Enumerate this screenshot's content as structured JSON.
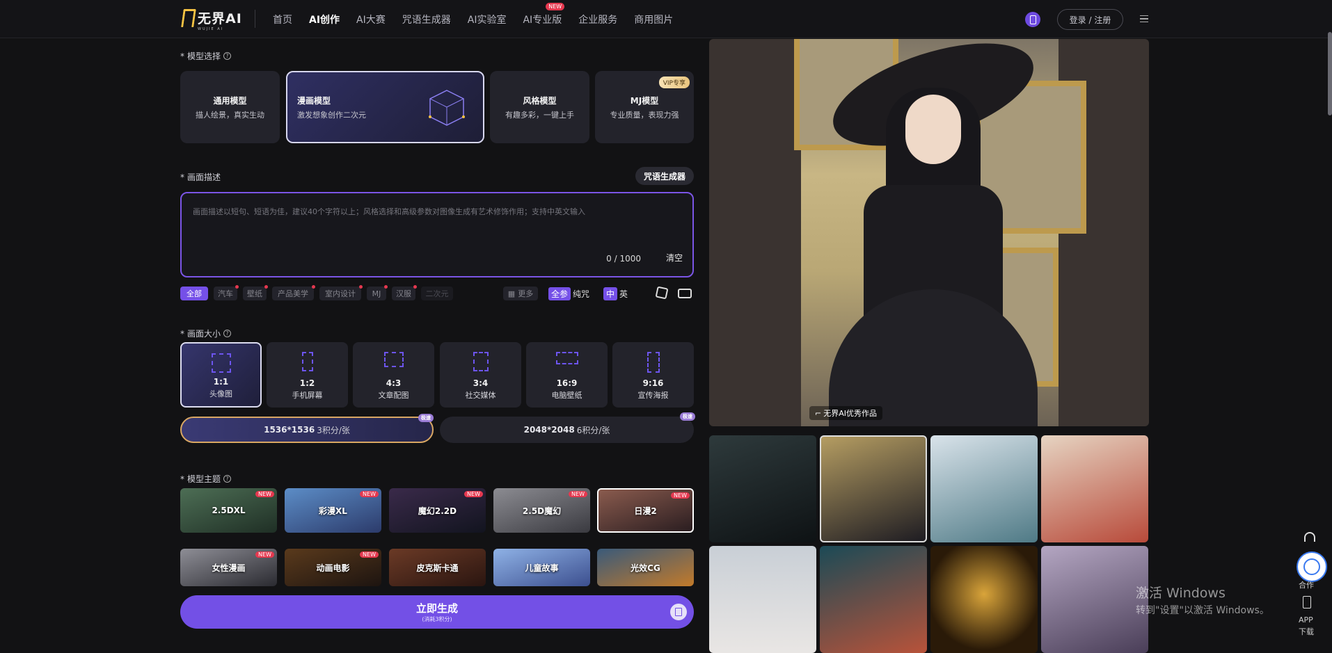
{
  "brand": {
    "name": "无界AI",
    "sub": "WUJIE AI"
  },
  "nav": [
    {
      "label": "首页"
    },
    {
      "label": "AI创作",
      "active": true
    },
    {
      "label": "AI大赛"
    },
    {
      "label": "咒语生成器"
    },
    {
      "label": "AI实验室"
    },
    {
      "label": "AI专业版",
      "badge": "NEW"
    },
    {
      "label": "企业服务"
    },
    {
      "label": "商用图片"
    }
  ],
  "header": {
    "login_label": "登录 / 注册"
  },
  "model_section": {
    "label": "模型选择",
    "cards": [
      {
        "title": "通用模型",
        "desc": "描人绘景，真实生动"
      },
      {
        "title": "漫画模型",
        "desc": "激发想象创作二次元",
        "selected": true
      },
      {
        "title": "风格模型",
        "desc": "有趣多彩，一键上手"
      },
      {
        "title": "MJ模型",
        "desc": "专业质量，表现力强",
        "badge": "VIP专享"
      }
    ]
  },
  "desc_section": {
    "label": "画面描述",
    "spell_button": "咒语生成器",
    "placeholder": "画面描述以短句、短语为佳，建议40个字符以上；风格选择和高级参数对图像生成有艺术修饰作用；支持中英文输入",
    "counter": "0 / 1000",
    "clear": "清空"
  },
  "tags": [
    {
      "label": "全部",
      "active": true
    },
    {
      "label": "汽车",
      "dot": true
    },
    {
      "label": "壁纸",
      "dot": true
    },
    {
      "label": "产品美学",
      "dot": true
    },
    {
      "label": "室内设计",
      "dot": true
    },
    {
      "label": "MJ",
      "dot": true
    },
    {
      "label": "汉服",
      "dot": true
    },
    {
      "label": "二次元",
      "fade": true
    }
  ],
  "tag_tools": {
    "more": "更多",
    "full_label": "全参",
    "pure_label": "纯咒",
    "zh_label": "中",
    "en_label": "英"
  },
  "size_section": {
    "label": "画面大小",
    "cards": [
      {
        "ratio": "1:1",
        "name": "头像图",
        "selected": true
      },
      {
        "ratio": "1:2",
        "name": "手机屏幕"
      },
      {
        "ratio": "4:3",
        "name": "文章配图"
      },
      {
        "ratio": "3:4",
        "name": "社交媒体"
      },
      {
        "ratio": "16:9",
        "name": "电脑壁纸"
      },
      {
        "ratio": "9:16",
        "name": "宣传海报"
      }
    ],
    "resolutions": [
      {
        "size": "1536*1536",
        "cost": "3积分/张",
        "badge": "极速",
        "selected": true
      },
      {
        "size": "2048*2048",
        "cost": "6积分/张",
        "badge": "极速"
      }
    ]
  },
  "theme_section": {
    "label": "模型主题",
    "items": [
      {
        "name": "2.5DXL",
        "badge": "NEW"
      },
      {
        "name": "彩漫XL",
        "badge": "NEW"
      },
      {
        "name": "魔幻2.2D",
        "badge": "NEW"
      },
      {
        "name": "2.5D魔幻",
        "badge": "NEW"
      },
      {
        "name": "日漫2",
        "badge": "NEW",
        "selected": true
      },
      {
        "name": "女性漫画",
        "badge": "NEW"
      },
      {
        "name": "动画电影",
        "badge": "NEW"
      },
      {
        "name": "皮克斯卡通"
      },
      {
        "name": "儿童故事"
      },
      {
        "name": "光效CG"
      }
    ]
  },
  "generate": {
    "label": "立即生成",
    "cost": "(消耗3积分)"
  },
  "gallery": {
    "hero_caption": "无界AI优秀作品"
  },
  "side_tools": {
    "coop": "合作",
    "app": "APP",
    "download": "下载"
  },
  "watermark": {
    "line1": "激活 Windows",
    "line2": "转到\"设置\"以激活 Windows。"
  },
  "colors": {
    "accent": "#7350e6",
    "badge_red": "#e5384f",
    "gold": "#f6c343"
  }
}
